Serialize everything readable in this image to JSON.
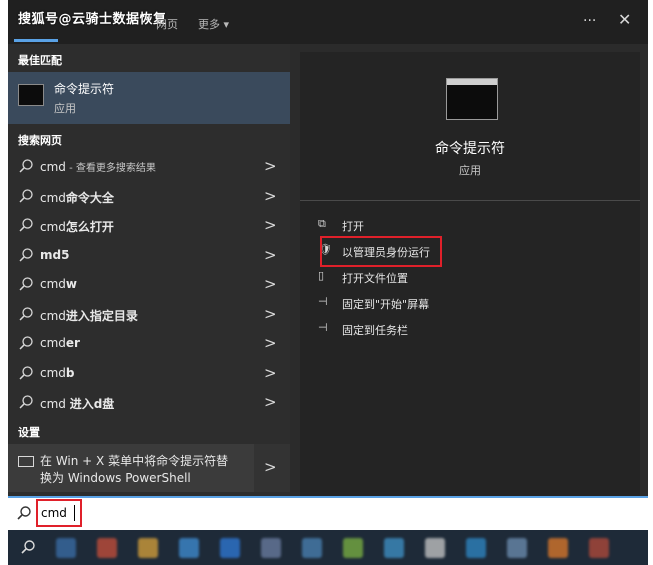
{
  "header": {
    "watermark": "搜狐号@云骑士数据恢复",
    "tab_partial": "网页",
    "more_label": "更多 ▾",
    "more_icon": "chevron-down-icon",
    "options_label": "···",
    "close_label": "✕"
  },
  "left": {
    "best_match_heading": "最佳匹配",
    "best_match": {
      "title": "命令提示符",
      "subtitle": "应用",
      "icon": "command-prompt-icon"
    },
    "web_heading": "搜索网页",
    "web_results": [
      {
        "prefix": "cmd",
        "suffix": " - 查看更多搜索结果"
      },
      {
        "prefix": "cmd",
        "suffix": "命令大全"
      },
      {
        "prefix": "cmd",
        "suffix": "怎么打开"
      },
      {
        "prefix": "",
        "suffix": "md5"
      },
      {
        "prefix": "cmd",
        "suffix": "w"
      },
      {
        "prefix": "cmd",
        "suffix": "进入指定目录"
      },
      {
        "prefix": "cmd",
        "suffix": "er"
      },
      {
        "prefix": "cmd",
        "suffix": "b"
      },
      {
        "prefix": "cmd ",
        "suffix": "进入d盘"
      }
    ],
    "settings_heading": "设置",
    "setting": {
      "line1": "在 Win + X 菜单中将命令提示符替",
      "line2": "换为 Windows PowerShell"
    }
  },
  "right": {
    "app_title": "命令提示符",
    "app_subtitle": "应用",
    "actions": [
      {
        "icon": "open-icon",
        "glyph": "⧉",
        "label": "打开"
      },
      {
        "icon": "admin-shield-icon",
        "glyph": "🛡",
        "label": "以管理员身份运行"
      },
      {
        "icon": "folder-icon",
        "glyph": "▯",
        "label": "打开文件位置"
      },
      {
        "icon": "pin-icon",
        "glyph": "⊣",
        "label": "固定到\"开始\"屏幕"
      },
      {
        "icon": "pin-taskbar-icon",
        "glyph": "⊣",
        "label": "固定到任务栏"
      }
    ]
  },
  "search": {
    "value": "cmd"
  },
  "colors": {
    "accent": "#5aa2e6",
    "highlight": "#e0202a",
    "best_match_bg": "#3a4a5c"
  }
}
